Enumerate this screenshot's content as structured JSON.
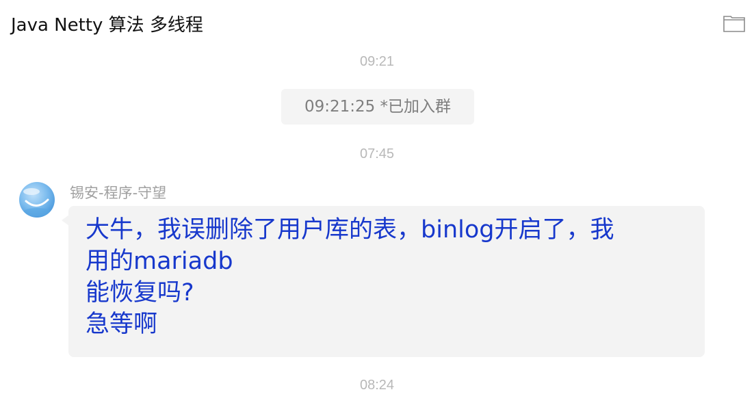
{
  "chat": {
    "title": "Java Netty 算法 多线程",
    "folder_icon": "folder-icon"
  },
  "messages": {
    "time_1": "09:21",
    "system_text": "09:21:25 *已加入群",
    "time_2": "07:45",
    "sender_name": "锡安-程序-守望",
    "message_lines": [
      "大牛，我误删除了用户库的表，binlog开启了，我",
      "用的mariadb",
      "能恢复吗?",
      "急等啊"
    ],
    "time_3": "08:24"
  },
  "colors": {
    "message_text": "#1738cc",
    "bubble_bg": "#f3f3f3",
    "timestamp": "#b8b8b8",
    "avatar_blue": "#6fb3ea"
  }
}
